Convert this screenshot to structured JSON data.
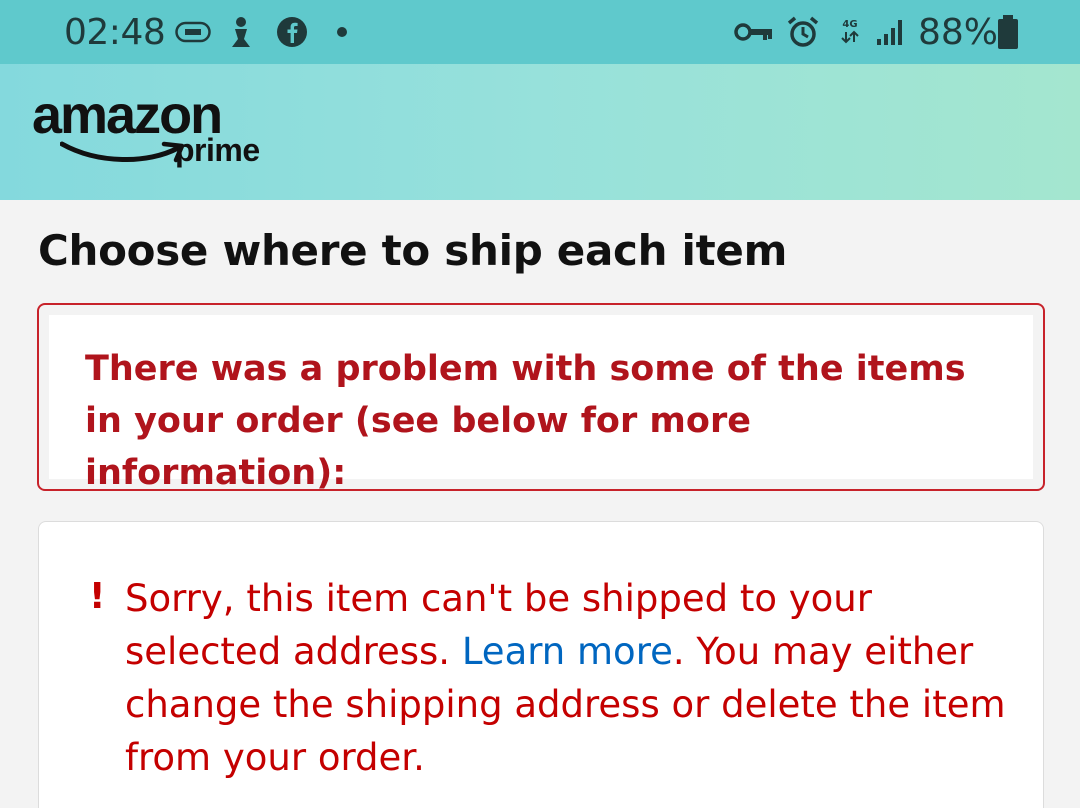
{
  "status_bar": {
    "time": "02:48",
    "battery": "88%",
    "left_icons": [
      "vpn-tag-icon",
      "chess-icon",
      "facebook-icon",
      "dot-icon"
    ],
    "right_icons": [
      "key-icon",
      "alarm-icon",
      "4g-lte-icon",
      "signal-icon",
      "battery-icon"
    ],
    "network_label": "4G"
  },
  "header": {
    "logo_word": "amazon",
    "logo_sub": "prime"
  },
  "page": {
    "title": "Choose where to ship each item"
  },
  "alert": {
    "message": "There was a problem with some of the items in your order (see below for more information):"
  },
  "item_error": {
    "icon": "!",
    "text_before": "Sorry, this item can't be shipped to your selected address.",
    "link": "Learn more",
    "text_after": ". You may either change the shipping address or delete the item from your order."
  },
  "colors": {
    "status_bar": "#5fc9cc",
    "error_red": "#c40000",
    "link_blue": "#0066c0"
  }
}
